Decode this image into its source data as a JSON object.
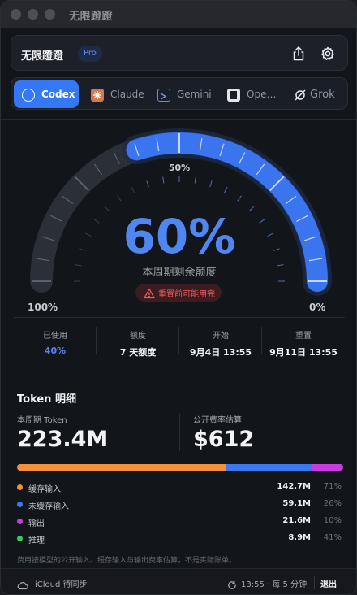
{
  "window": {
    "title": "无限蹬蹬"
  },
  "header": {
    "app_name": "无限蹬蹬",
    "badge": "Pro",
    "share_icon": "share-icon",
    "settings_icon": "gear-icon"
  },
  "tabs": [
    {
      "label": "Codex",
      "active": true,
      "icon": "openai-icon",
      "icon_color": "#ffffff"
    },
    {
      "label": "Claude",
      "active": false,
      "icon": "claude-icon",
      "icon_color": "#d9774c"
    },
    {
      "label": "Gemini",
      "active": false,
      "icon": "gemini-icon",
      "icon_color": "#6b8cf2"
    },
    {
      "label": "Ope…",
      "active": false,
      "icon": "opencode-icon",
      "icon_color": "#e6e6e6"
    },
    {
      "label": "Grok",
      "active": false,
      "icon": "grok-icon",
      "icon_color": "#e6e6e6"
    }
  ],
  "gauge": {
    "remaining_percent": 0.6,
    "value_text": "60%",
    "caption": "本周期剩余额度",
    "warning": "重置前可能用完",
    "top_label": "50%",
    "left_label": "100%",
    "right_label": "0%"
  },
  "stats": [
    {
      "label": "已使用",
      "value": "40%",
      "highlight": true
    },
    {
      "label": "额度",
      "value": "7 天额度",
      "highlight": false
    },
    {
      "label": "开始",
      "value": "9月4日 13:55",
      "highlight": false
    },
    {
      "label": "重置",
      "value": "9月11日 13:55",
      "highlight": false
    }
  ],
  "token": {
    "title": "Token 明细",
    "period_label": "本周期 Token",
    "period_value": "223.4M",
    "cost_label": "公开费率估算",
    "cost_value": "$612",
    "bar": [
      {
        "name": "缓存输入",
        "share": 0.64,
        "color": "#f5903a"
      },
      {
        "name": "未缓存输入",
        "share": 0.265,
        "color": "#3b78f0"
      },
      {
        "name": "输出",
        "share": 0.095,
        "color": "#c93ae0"
      }
    ],
    "legend": [
      {
        "name": "缓存输入",
        "value": "142.7M",
        "percent": "71%",
        "color": "#f5903a"
      },
      {
        "name": "未缓存输入",
        "value": "59.1M",
        "percent": "26%",
        "color": "#3b78f0"
      },
      {
        "name": "输出",
        "value": "21.6M",
        "percent": "10%",
        "color": "#c93ae0"
      },
      {
        "name": "推理",
        "value": "8.9M",
        "percent": "41%",
        "color": "#38c759"
      }
    ],
    "footnote": "费用按模型的公开输入、缓存输入与输出费率估算，不是实际账单。"
  },
  "status": {
    "sync": "iCloud 待同步",
    "time": "13:55 · 每 5 分钟",
    "quit": "退出"
  }
}
